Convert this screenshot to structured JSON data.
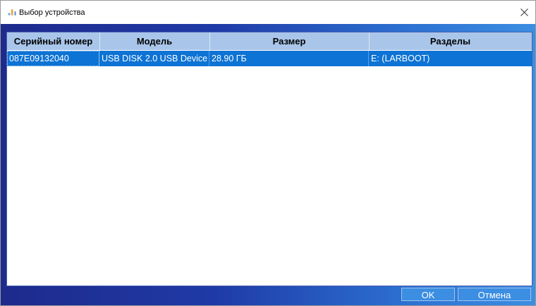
{
  "window": {
    "title": "Выбор устройства",
    "app_icon": "dropper-icon",
    "close_symbol": "×"
  },
  "table": {
    "columns": [
      "Серийный номер",
      "Модель",
      "Размер",
      "Разделы"
    ],
    "rows": [
      {
        "serial": "087E09132040",
        "model": "USB DISK 2.0 USB Device",
        "size": "28.90 ГБ",
        "partitions": "E: (LARBOOT)",
        "selected": true
      }
    ]
  },
  "buttons": {
    "ok": "OK",
    "cancel": "Отмена"
  },
  "colors": {
    "header_bg": "#a9c6ea",
    "selection": "#0d73d4",
    "client_gradient_start": "#1e2a8c",
    "client_gradient_end": "#3b8ee2"
  }
}
